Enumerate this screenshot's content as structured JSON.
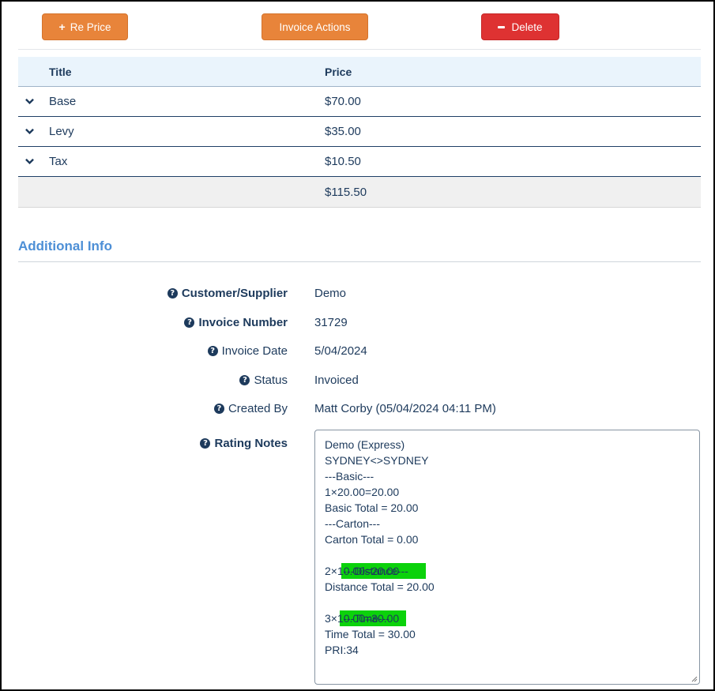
{
  "toolbar": {
    "reprice_label": "Re Price",
    "invoice_actions_label": "Invoice Actions",
    "delete_label": "Delete"
  },
  "price_table": {
    "headers": {
      "title": "Title",
      "price": "Price"
    },
    "rows": [
      {
        "title": "Base",
        "price": "$70.00"
      },
      {
        "title": "Levy",
        "price": "$35.00"
      },
      {
        "title": "Tax",
        "price": "$10.50"
      }
    ],
    "total": "$115.50"
  },
  "additional_info": {
    "title": "Additional Info",
    "fields": [
      {
        "label": "Customer/Supplier",
        "value": "Demo"
      },
      {
        "label": "Invoice Number",
        "value": "31729"
      },
      {
        "label": "Invoice Date",
        "value": "5/04/2024"
      },
      {
        "label": "Status",
        "value": "Invoiced"
      },
      {
        "label": "Created By",
        "value": "Matt Corby (05/04/2024 04:11 PM)"
      }
    ],
    "rating_notes_label": "Rating Notes",
    "rating_notes": [
      "Demo (Express)",
      "SYDNEY<>SYDNEY",
      "---Basic---",
      "1×20.00=20.00",
      "Basic Total = 20.00",
      "---Carton---",
      "Carton Total = 0.00",
      "---Distance---",
      "2×10.00=20.00",
      "Distance Total = 20.00",
      "---Time---",
      "3×10.00=30.00",
      "Time Total = 30.00",
      "PRI:34"
    ]
  },
  "colors": {
    "button_orange": "#e8843a",
    "button_red": "#de3232",
    "highlight_green": "#0bd20b",
    "section_title": "#4d8fd6",
    "text_navy": "#1d3a5c"
  }
}
